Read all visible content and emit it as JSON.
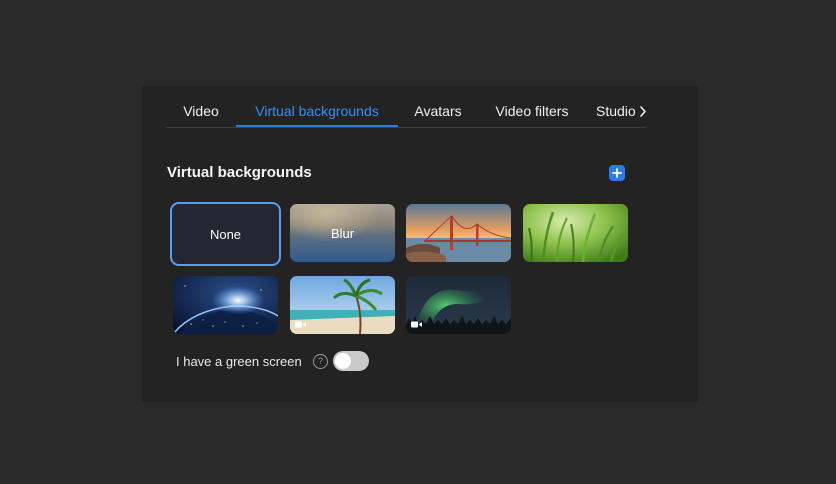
{
  "tabs": [
    {
      "label": "Video",
      "active": false
    },
    {
      "label": "Virtual backgrounds",
      "active": true
    },
    {
      "label": "Avatars",
      "active": false
    },
    {
      "label": "Video filters",
      "active": false
    },
    {
      "label": "Studio",
      "active": false
    }
  ],
  "tab_overflow_icon": "chevron-right-icon",
  "section": {
    "title": "Virtual backgrounds",
    "add_icon": "plus-icon"
  },
  "backgrounds": [
    {
      "label": "None",
      "selected": true
    },
    {
      "label": "Blur",
      "selected": false
    },
    {
      "name": "golden-gate-bridge",
      "selected": false
    },
    {
      "name": "grass",
      "selected": false
    },
    {
      "name": "earth-from-space",
      "selected": false
    },
    {
      "name": "beach",
      "video": true,
      "selected": false
    },
    {
      "name": "northern-lights",
      "video": true,
      "selected": false
    }
  ],
  "green_screen": {
    "label": "I have a green screen",
    "help_icon": "question-mark-icon",
    "help_glyph": "?",
    "enabled": false
  },
  "colors": {
    "accent": "#2d7ce6",
    "panel": "#232323",
    "background": "#2a2a2a"
  }
}
